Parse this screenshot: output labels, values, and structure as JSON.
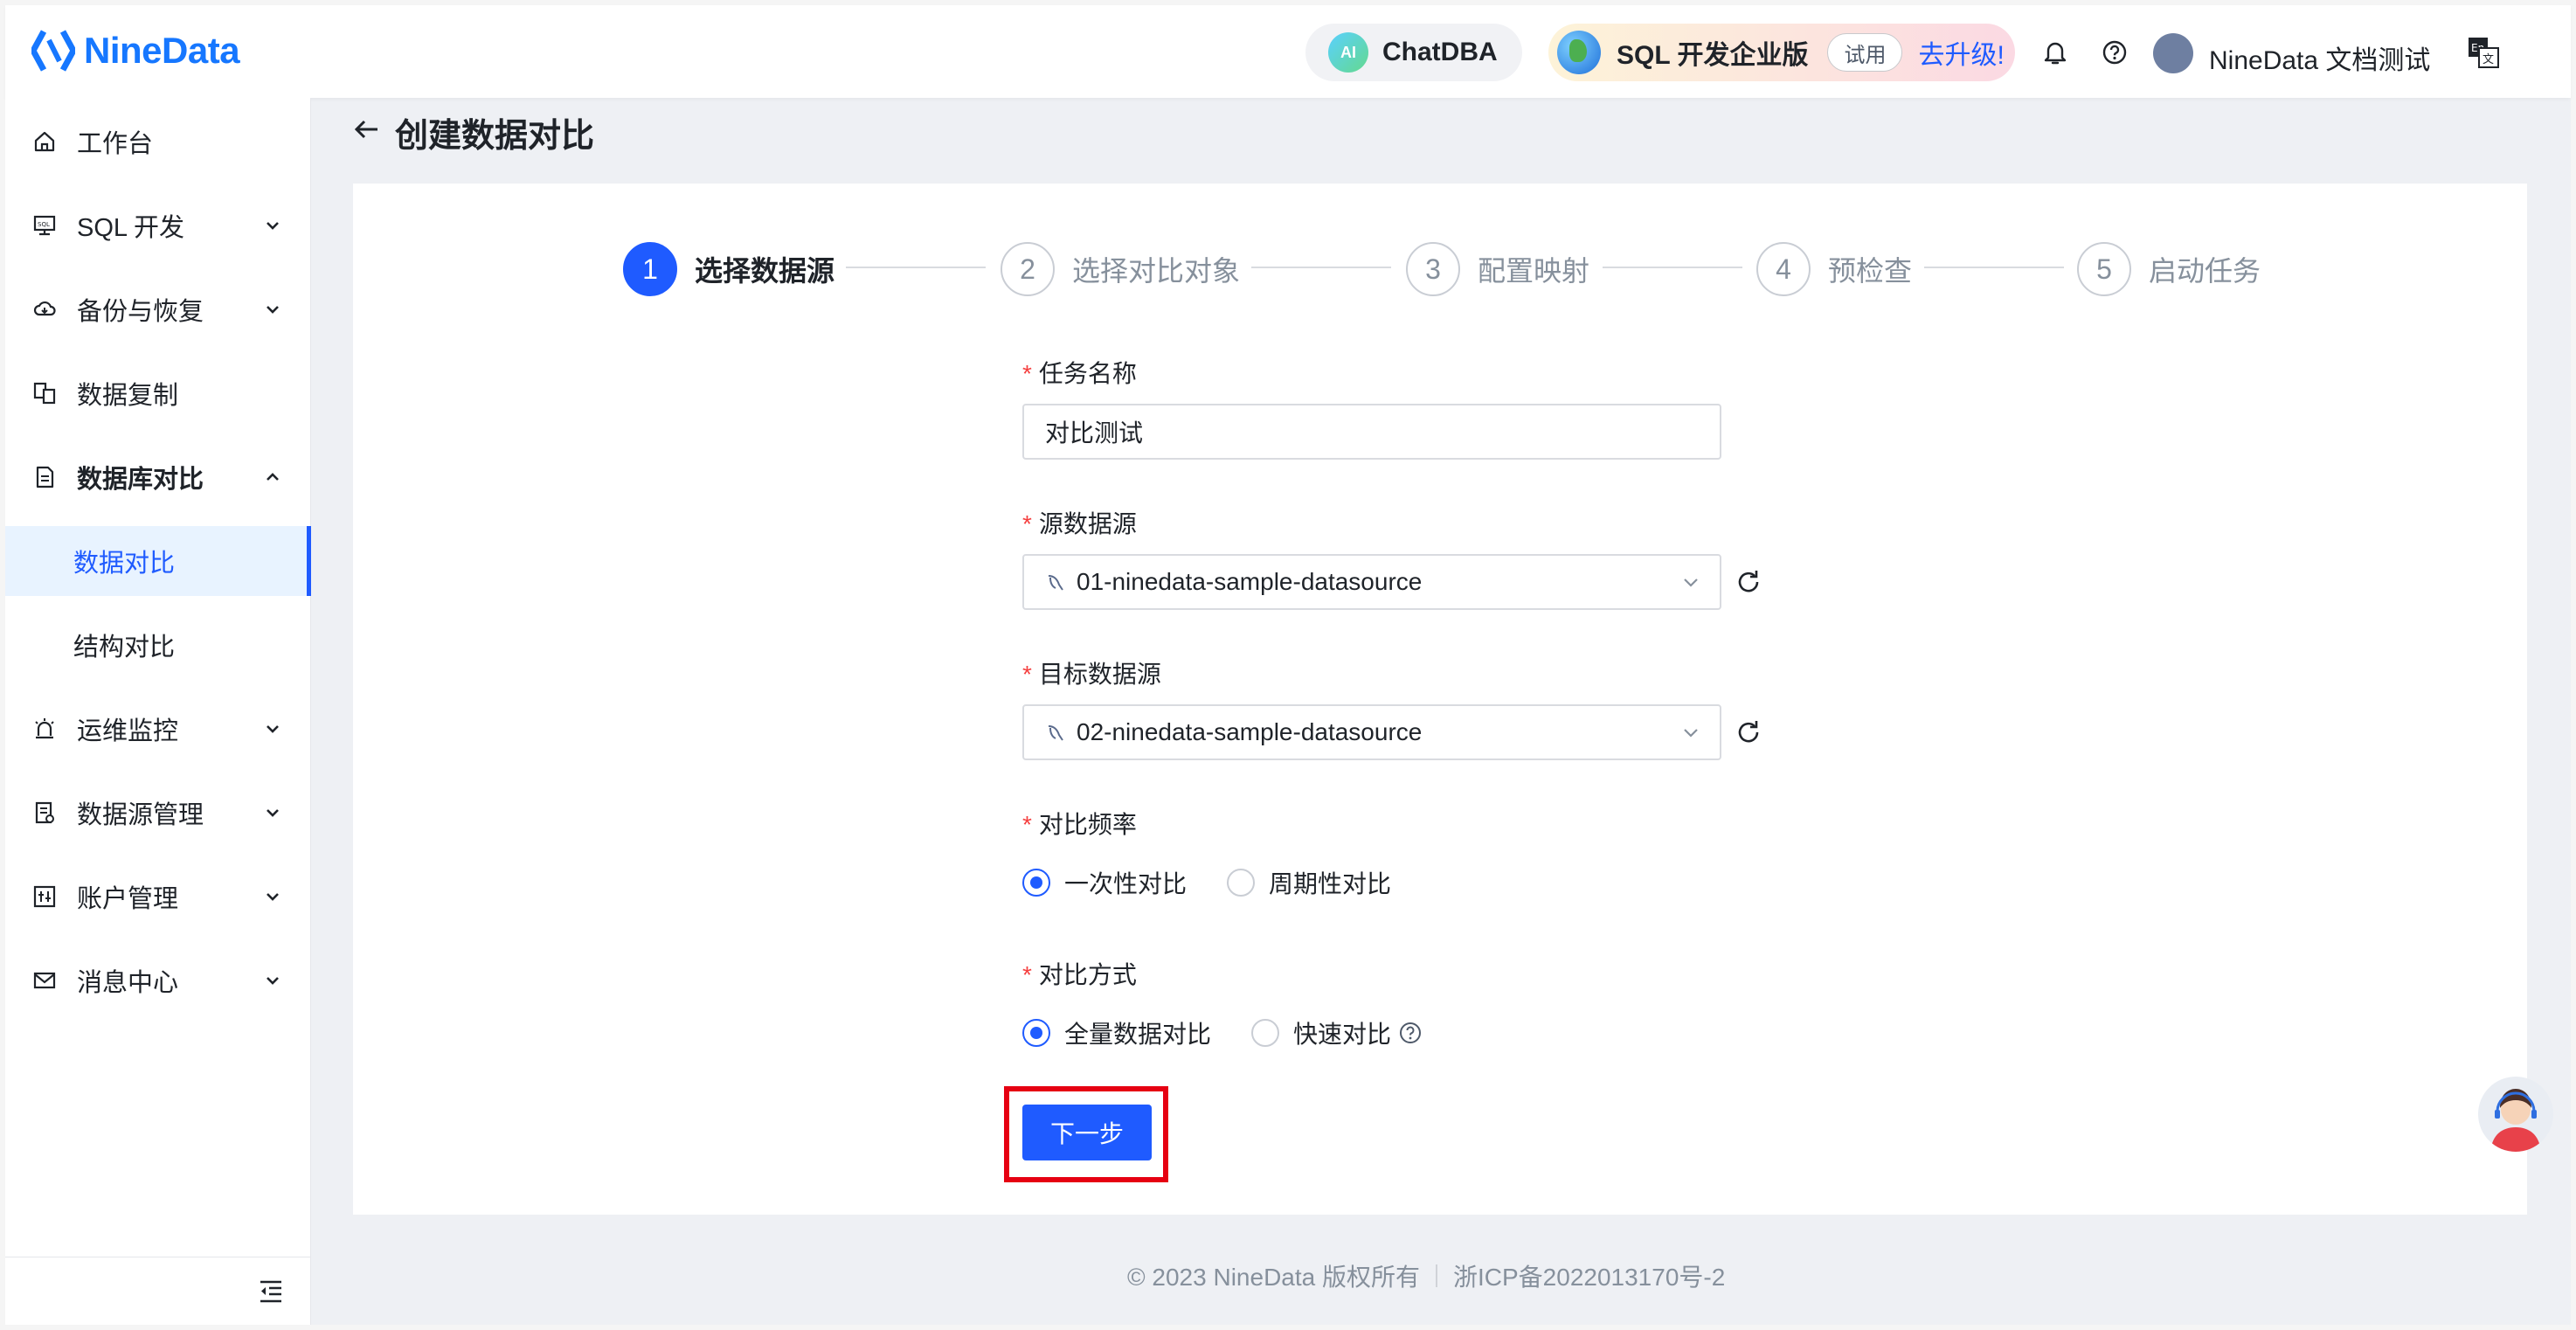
{
  "header": {
    "logo_text": "NineData",
    "chatdba_ai": "AI",
    "chatdba_label": "ChatDBA",
    "edition_label": "SQL 开发企业版",
    "trial_badge": "试用",
    "upgrade_link": "去升级!",
    "user_name": "NineData 文档测试"
  },
  "sidebar": {
    "items": [
      {
        "label": "工作台"
      },
      {
        "label": "SQL 开发"
      },
      {
        "label": "备份与恢复"
      },
      {
        "label": "数据复制"
      },
      {
        "label": "数据库对比"
      },
      {
        "label": "数据对比"
      },
      {
        "label": "结构对比"
      },
      {
        "label": "运维监控"
      },
      {
        "label": "数据源管理"
      },
      {
        "label": "账户管理"
      },
      {
        "label": "消息中心"
      }
    ]
  },
  "page": {
    "title": "创建数据对比"
  },
  "steps": [
    {
      "num": "1",
      "label": "选择数据源"
    },
    {
      "num": "2",
      "label": "选择对比对象"
    },
    {
      "num": "3",
      "label": "配置映射"
    },
    {
      "num": "4",
      "label": "预检查"
    },
    {
      "num": "5",
      "label": "启动任务"
    }
  ],
  "form": {
    "required_mark": "*",
    "task_name_label": "任务名称",
    "task_name_value": "对比测试",
    "source_label": "源数据源",
    "source_value": "01-ninedata-sample-datasource",
    "target_label": "目标数据源",
    "target_value": "02-ninedata-sample-datasource",
    "frequency_label": "对比频率",
    "frequency_options": [
      "一次性对比",
      "周期性对比"
    ],
    "method_label": "对比方式",
    "method_options": [
      "全量数据对比",
      "快速对比"
    ],
    "next_button": "下一步"
  },
  "footer": {
    "copyright": "© 2023 NineData 版权所有",
    "icp": "浙ICP备2022013170号-2"
  },
  "colors": {
    "primary": "#1f5bff",
    "required": "#f53f3f",
    "highlight_border": "#e60012"
  }
}
